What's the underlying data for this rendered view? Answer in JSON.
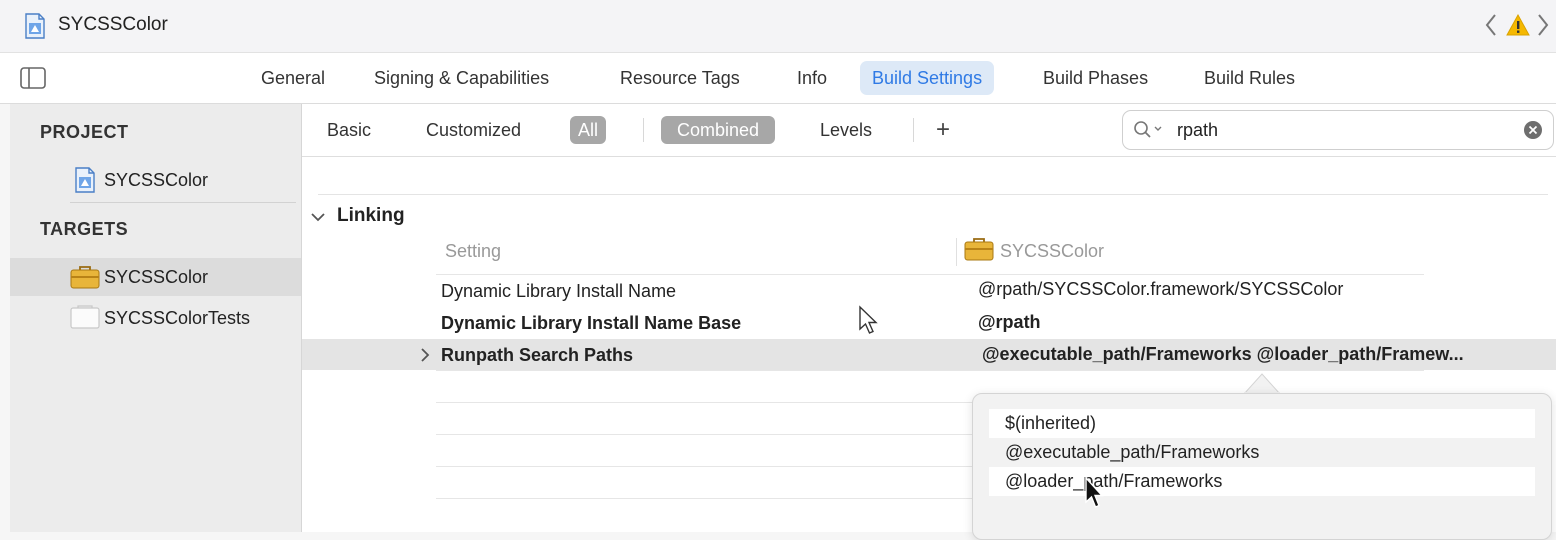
{
  "window": {
    "title": "SYCSSColor"
  },
  "icons": {
    "app": "xcode-project-icon",
    "back": "chevron-left-icon",
    "warning": "warning-triangle-icon",
    "forward": "chevron-right-icon",
    "sidebar_toggle": "sidebar-toggle-icon",
    "target": "framework-toolbox-icon",
    "test_target": "test-bundle-icon",
    "search": "magnifier-icon",
    "clear": "clear-circle-icon",
    "add": "plus-icon"
  },
  "colors": {
    "accent": "#2f7ae5",
    "selected_tab_bg": "#dde9f7",
    "pill_bg": "#a7a7a7",
    "warning": "#f5b800"
  },
  "tabs": [
    {
      "label": "General"
    },
    {
      "label": "Signing & Capabilities"
    },
    {
      "label": "Resource Tags"
    },
    {
      "label": "Info"
    },
    {
      "label": "Build Settings",
      "active": true
    },
    {
      "label": "Build Phases"
    },
    {
      "label": "Build Rules"
    }
  ],
  "sidebar": {
    "project_header": "PROJECT",
    "project_item": "SYCSSColor",
    "targets_header": "TARGETS",
    "targets": [
      {
        "label": "SYCSSColor",
        "selected": true
      },
      {
        "label": "SYCSSColorTests"
      }
    ]
  },
  "filters": {
    "basic": "Basic",
    "customized": "Customized",
    "all": "All",
    "combined": "Combined",
    "levels": "Levels",
    "add_label": "+"
  },
  "search": {
    "value": "rpath"
  },
  "section": {
    "title": "Linking",
    "setting_header": "Setting",
    "target_header": "SYCSSColor",
    "rows": [
      {
        "name": "Dynamic Library Install Name",
        "value": "@rpath/SYCSSColor.framework/SYCSSColor"
      },
      {
        "name": "Dynamic Library Install Name Base",
        "value": "@rpath"
      },
      {
        "name": "Runpath Search Paths",
        "value": "@executable_path/Frameworks @loader_path/Framew..."
      }
    ]
  },
  "popover": {
    "items": [
      "$(inherited)",
      "@executable_path/Frameworks",
      "@loader_path/Frameworks"
    ]
  }
}
